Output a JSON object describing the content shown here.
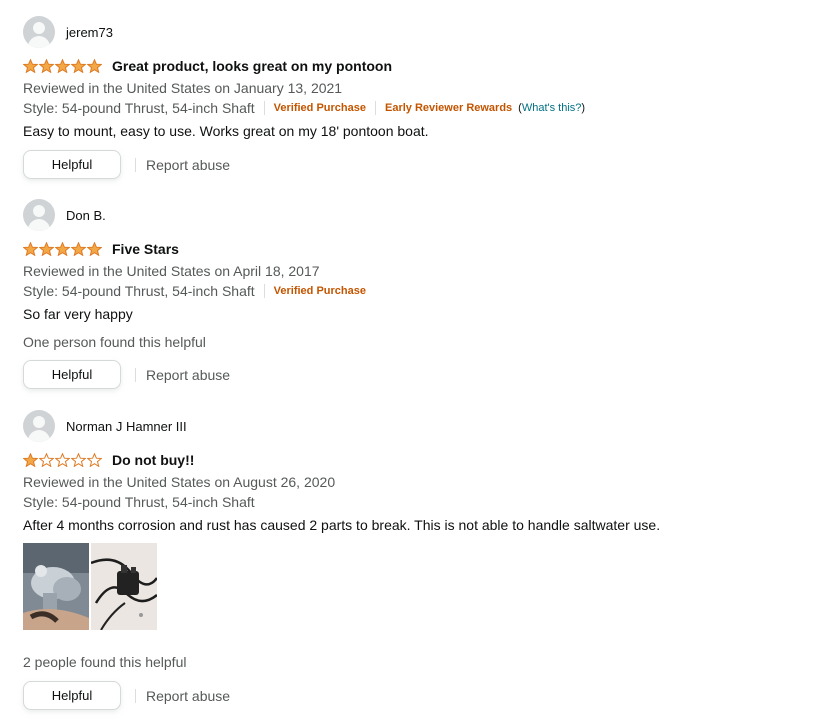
{
  "colors": {
    "star_fill": "#f3a847",
    "star_stroke": "#de7921",
    "verified": "#c45500",
    "link": "#007185",
    "muted": "#565959"
  },
  "labels": {
    "helpful_button": "Helpful",
    "report_abuse": "Report abuse"
  },
  "reviews": [
    {
      "author": "jerem73",
      "rating": 5,
      "title": "Great product, looks great on my pontoon",
      "date": "Reviewed in the United States on January 13, 2021",
      "style": "Style: 54-pound Thrust, 54-inch Shaft",
      "verified": "Verified Purchase",
      "early_reviewer": "Early Reviewer Rewards",
      "whats_this_open": "(",
      "whats_this": "What's this?",
      "whats_this_close": ")",
      "body": "Easy to mount, easy to use. Works great on my 18' pontoon boat."
    },
    {
      "author": "Don B.",
      "rating": 5,
      "title": "Five Stars",
      "date": "Reviewed in the United States on April 18, 2017",
      "style": "Style: 54-pound Thrust, 54-inch Shaft",
      "verified": "Verified Purchase",
      "body": "So far very happy",
      "helpful_count": "One person found this helpful"
    },
    {
      "author": "Norman J Hamner III",
      "rating": 1,
      "title": "Do not buy!!",
      "date": "Reviewed in the United States on August 26, 2020",
      "style": "Style: 54-pound Thrust, 54-inch Shaft",
      "body": "After 4 months corrosion and rust has caused 2 parts to break. This is not able to handle saltwater use.",
      "images": [
        "corroded-motor-bracket-photo",
        "broken-cable-clip-photo"
      ],
      "helpful_count": "2 people found this helpful"
    }
  ]
}
